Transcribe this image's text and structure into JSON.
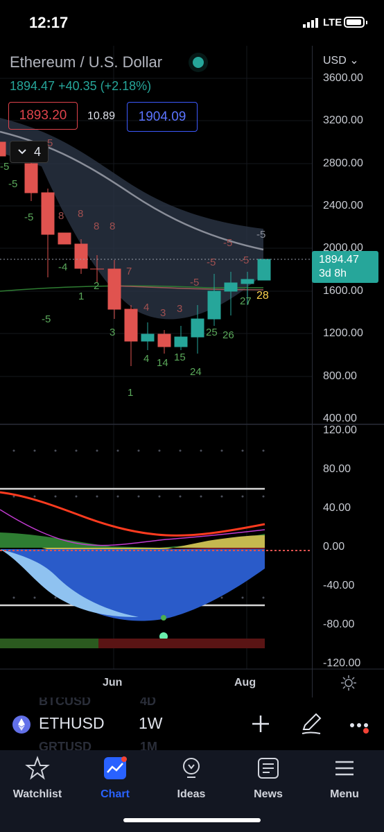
{
  "status_bar": {
    "time": "12:17",
    "network": "LTE"
  },
  "header": {
    "title": "Ethereum / U.S. Dollar",
    "change": "1894.47  +40.35 (+2.18%)",
    "bid": "1893.20",
    "spread": "10.89",
    "ask": "1904.09",
    "indicator_count": "4",
    "currency": "USD"
  },
  "price_axis": [
    "3600.00",
    "3200.00",
    "2800.00",
    "2400.00",
    "2000.00",
    "1600.00",
    "1200.00",
    "800.00",
    "400.00"
  ],
  "current_price": {
    "price": "1894.47",
    "countdown": "3d 8h"
  },
  "osc_axis": [
    "120.00",
    "80.00",
    "40.00",
    "0.00",
    "-40.00",
    "-80.00",
    "-120.00"
  ],
  "time_axis": [
    "Jun",
    "Aug"
  ],
  "annotations": {
    "red": [
      "5",
      "5",
      "8",
      "8",
      "8",
      "7",
      "4",
      "3",
      "3",
      "-5",
      "-5",
      "-5",
      "-5",
      "-5"
    ],
    "green": [
      "-5",
      "-5",
      "-4",
      "1",
      "2",
      "3",
      "-5",
      "4",
      "14",
      "15",
      "24",
      "25",
      "26",
      "27",
      "1"
    ],
    "gray": [
      "-5"
    ],
    "yellow": [
      "28"
    ]
  },
  "toolbar": {
    "symbol": "ETHUSD",
    "interval": "1W",
    "ghost_symbol_top": "BTCUSD",
    "ghost_interval_top": "4D",
    "ghost_symbol_bottom": "GRTUSD",
    "ghost_interval_bottom": "1M"
  },
  "tabs": [
    {
      "label": "Watchlist",
      "icon": "star-icon"
    },
    {
      "label": "Chart",
      "icon": "chart-icon",
      "active": true
    },
    {
      "label": "Ideas",
      "icon": "lightbulb-icon"
    },
    {
      "label": "News",
      "icon": "newspaper-icon"
    },
    {
      "label": "Menu",
      "icon": "hamburger-icon"
    }
  ],
  "colors": {
    "up": "#26a69a",
    "down": "#e0534f",
    "accent": "#2962ff"
  }
}
